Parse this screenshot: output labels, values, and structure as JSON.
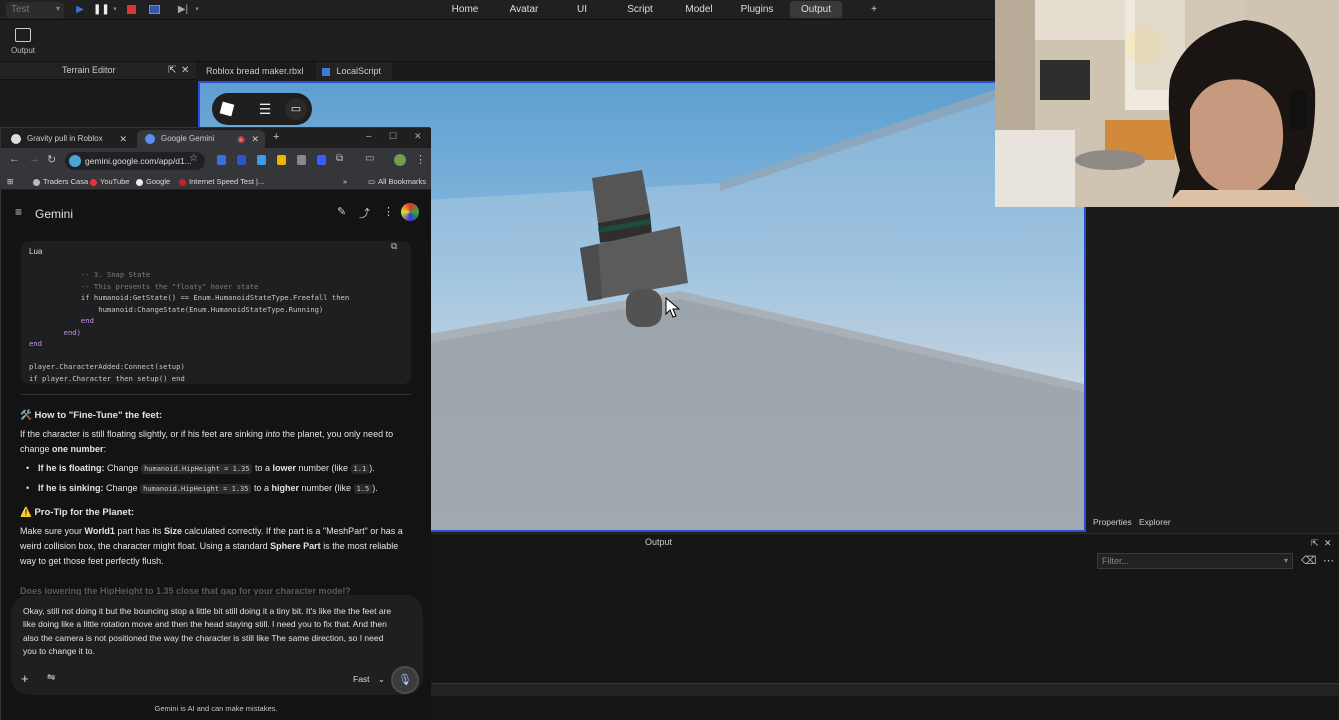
{
  "studio": {
    "test_select": "Test",
    "ribbon_tabs": [
      "Home",
      "Avatar",
      "UI",
      "Script",
      "Model",
      "Plugins",
      "Output"
    ],
    "add_tab": "+",
    "output_tool_label": "Output",
    "terrain_editor_title": "Terrain Editor",
    "doc_tabs": [
      "Roblox bread maker.rbxl",
      "LocalScript"
    ],
    "output_panel_title": "Output",
    "filter_placeholder": "Filter...",
    "properties_tab": "Properties",
    "explorer_tab": "Explorer"
  },
  "browser": {
    "tabs": [
      {
        "label": "Gravity pull in Roblox"
      },
      {
        "label": "Google Gemini"
      }
    ],
    "url": "gemini.google.com/app/d1...",
    "bookmarks": [
      "Traders Casa",
      "YouTube",
      "Google",
      "Internet Speed Test |...",
      "All Bookmarks"
    ]
  },
  "gemini": {
    "title": "Gemini",
    "code_lang": "Lua",
    "code_lines": [
      "            -- 3. Snap State",
      "            -- This prevents the \"floaty\" hover state",
      "            if humanoid:GetState() == Enum.HumanoidStateType.Freefall then",
      "                humanoid:ChangeState(Enum.HumanoidStateType.Running)",
      "            end",
      "        end)",
      "end",
      "",
      "player.CharacterAdded:Connect(setup)",
      "if player.Character then setup() end"
    ],
    "section1_title": "🛠️ How to \"Fine-Tune\" the feet:",
    "section1_p1": "If the character is still floating slightly, or if his feet are sinking",
    "section1_p1_em": "into",
    "section1_p1_end": "the planet, you only need to change",
    "section1_p1_bold": "one number",
    "bullet1_bold": "If he is floating:",
    "bullet1_a": "Change",
    "bullet1_code": "humanoid.HipHeight = 1.35",
    "bullet1_b": "to a",
    "bullet1_bold2": "lower",
    "bullet1_c": "number (like",
    "bullet1_code2": "1.1",
    "bullet1_d": ").",
    "bullet2_bold": "If he is sinking:",
    "bullet2_a": "Change",
    "bullet2_code": "humanoid.HipHeight = 1.35",
    "bullet2_b": "to a",
    "bullet2_bold2": "higher",
    "bullet2_c": "number (like",
    "bullet2_code2": "1.5",
    "bullet2_d": ").",
    "section2_title": "⚠️ Pro-Tip for the Planet:",
    "section2_p_a": "Make sure your",
    "section2_p_b1": "World1",
    "section2_p_c": "part has its",
    "section2_p_b2": "Size",
    "section2_p_d": "calculated correctly. If the part is a \"MeshPart\" or has a weird collision box, the character might float. Using a standard",
    "section2_p_b3": "Sphere Part",
    "section2_p_e": "is the most reliable way to get those feet perfectly flush.",
    "faded_question": "Does lowering the HipHeight to 1.35 close that gap for your character model?",
    "prompt_text": "Okay, still not doing it but the bouncing stop a little bit still doing it a tiny bit. It's like the the feet are like doing like a little rotation move and then the head staying still. I need you to fix that. And then also the camera is not positioned the way the character is still like The same direction, so I need you to change it to.",
    "mode_label": "Fast",
    "disclaimer": "Gemini is AI and can make mistakes."
  }
}
